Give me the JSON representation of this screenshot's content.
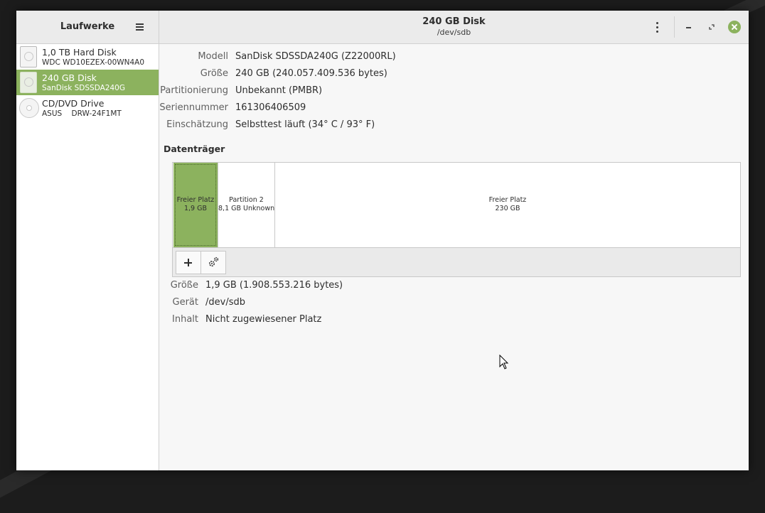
{
  "sidebar": {
    "title": "Laufwerke",
    "drives": [
      {
        "name": "1,0 TB Hard Disk",
        "sub": "WDC WD10EZEX-00WN4A0",
        "icon": "hard-disk-icon"
      },
      {
        "name": "240 GB Disk",
        "sub": "SanDisk SDSSDA240G",
        "icon": "hard-disk-icon"
      },
      {
        "name": "CD/DVD Drive",
        "sub": "ASUS    DRW-24F1MT",
        "icon": "optical-drive-icon"
      }
    ]
  },
  "header": {
    "title": "240 GB Disk",
    "subtitle": "/dev/sdb"
  },
  "properties": [
    {
      "label": "Modell",
      "value": "SanDisk SDSSDA240G (Z22000RL)"
    },
    {
      "label": "Größe",
      "value": "240 GB (240.057.409.536 bytes)"
    },
    {
      "label": "Partitionierung",
      "value": "Unbekannt (PMBR)"
    },
    {
      "label": "Seriennummer",
      "value": "161306406509"
    },
    {
      "label": "Einschätzung",
      "value": "Selbsttest läuft (34° C / 93° F)"
    }
  ],
  "volumes": {
    "title": "Datenträger",
    "segments": [
      {
        "line1": "Freier Platz",
        "line2": "1,9 GB"
      },
      {
        "line1": "Partition 2",
        "line2": "8,1 GB Unknown"
      },
      {
        "line1": "Freier Platz",
        "line2": "230 GB"
      }
    ]
  },
  "details": [
    {
      "label": "Größe",
      "value": "1,9 GB (1.908.553.216 bytes)"
    },
    {
      "label": "Gerät",
      "value": "/dev/sdb"
    },
    {
      "label": "Inhalt",
      "value": "Nicht zugewiesener Platz"
    }
  ],
  "colors": {
    "accent": "#8cb25e",
    "headerbar": "#ebebeb",
    "content_bg": "#f7f7f7"
  }
}
